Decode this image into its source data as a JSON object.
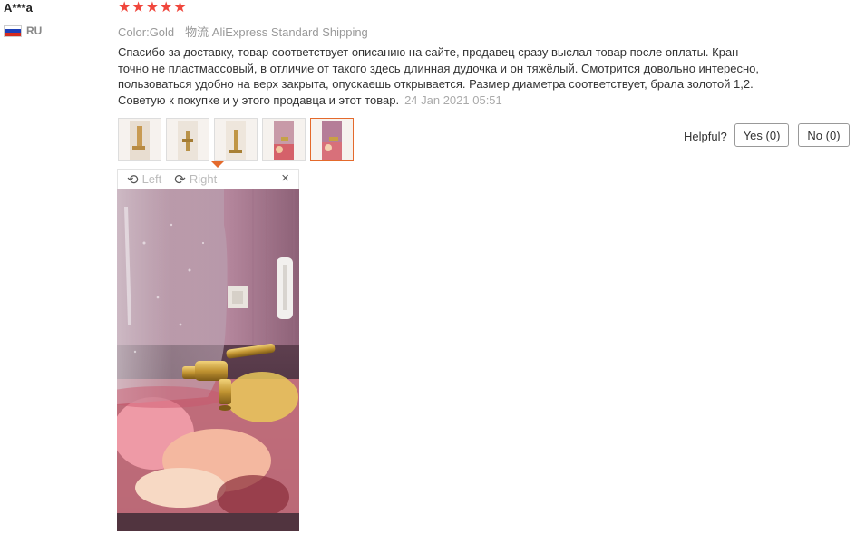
{
  "reviewer": {
    "name": "A***a",
    "country_code": "RU",
    "flag_colors": [
      "#ffffff",
      "#1d3fb8",
      "#d52b1e"
    ]
  },
  "rating": {
    "stars": 5,
    "star_symbol": "★",
    "star_color": "#f0463c"
  },
  "order_info": {
    "color_label": "Color:",
    "color_value": "Gold",
    "shipping_label": "物流",
    "shipping_value": "AliExpress Standard Shipping"
  },
  "review": {
    "text": "Спасибо за доставку, товар соответствует описанию на сайте, продавец сразу выслал товар после оплаты. Кран точно не пластмассовый, в отличие от такого здесь длинная дудочка и он тяжёлый. Смотрится довольно интересно, пользоваться удобно на верх закрыта, опускаешь открывается. Размер диаметра соответствует, брала золотой 1,2. Советую к покупке и у этого продавца и этот товар.",
    "date": "24 Jan 2021 05:51"
  },
  "thumbnails": [
    {
      "name": "photo-thumbnail-1",
      "active": false
    },
    {
      "name": "photo-thumbnail-2",
      "active": false
    },
    {
      "name": "photo-thumbnail-3",
      "active": false
    },
    {
      "name": "photo-thumbnail-4",
      "active": false
    },
    {
      "name": "photo-thumbnail-5",
      "active": true
    }
  ],
  "helpful": {
    "label": "Helpful?",
    "yes_label": "Yes (0)",
    "no_label": "No (0)"
  },
  "viewer": {
    "rotate_left_icon": "rotate-left-icon",
    "rotate_left_label": "Left",
    "rotate_right_icon": "rotate-right-icon",
    "rotate_right_label": "Right",
    "close_icon": "close-icon",
    "close_symbol": "×"
  },
  "colors": {
    "accent": "#e46a2c",
    "muted": "#999999"
  }
}
